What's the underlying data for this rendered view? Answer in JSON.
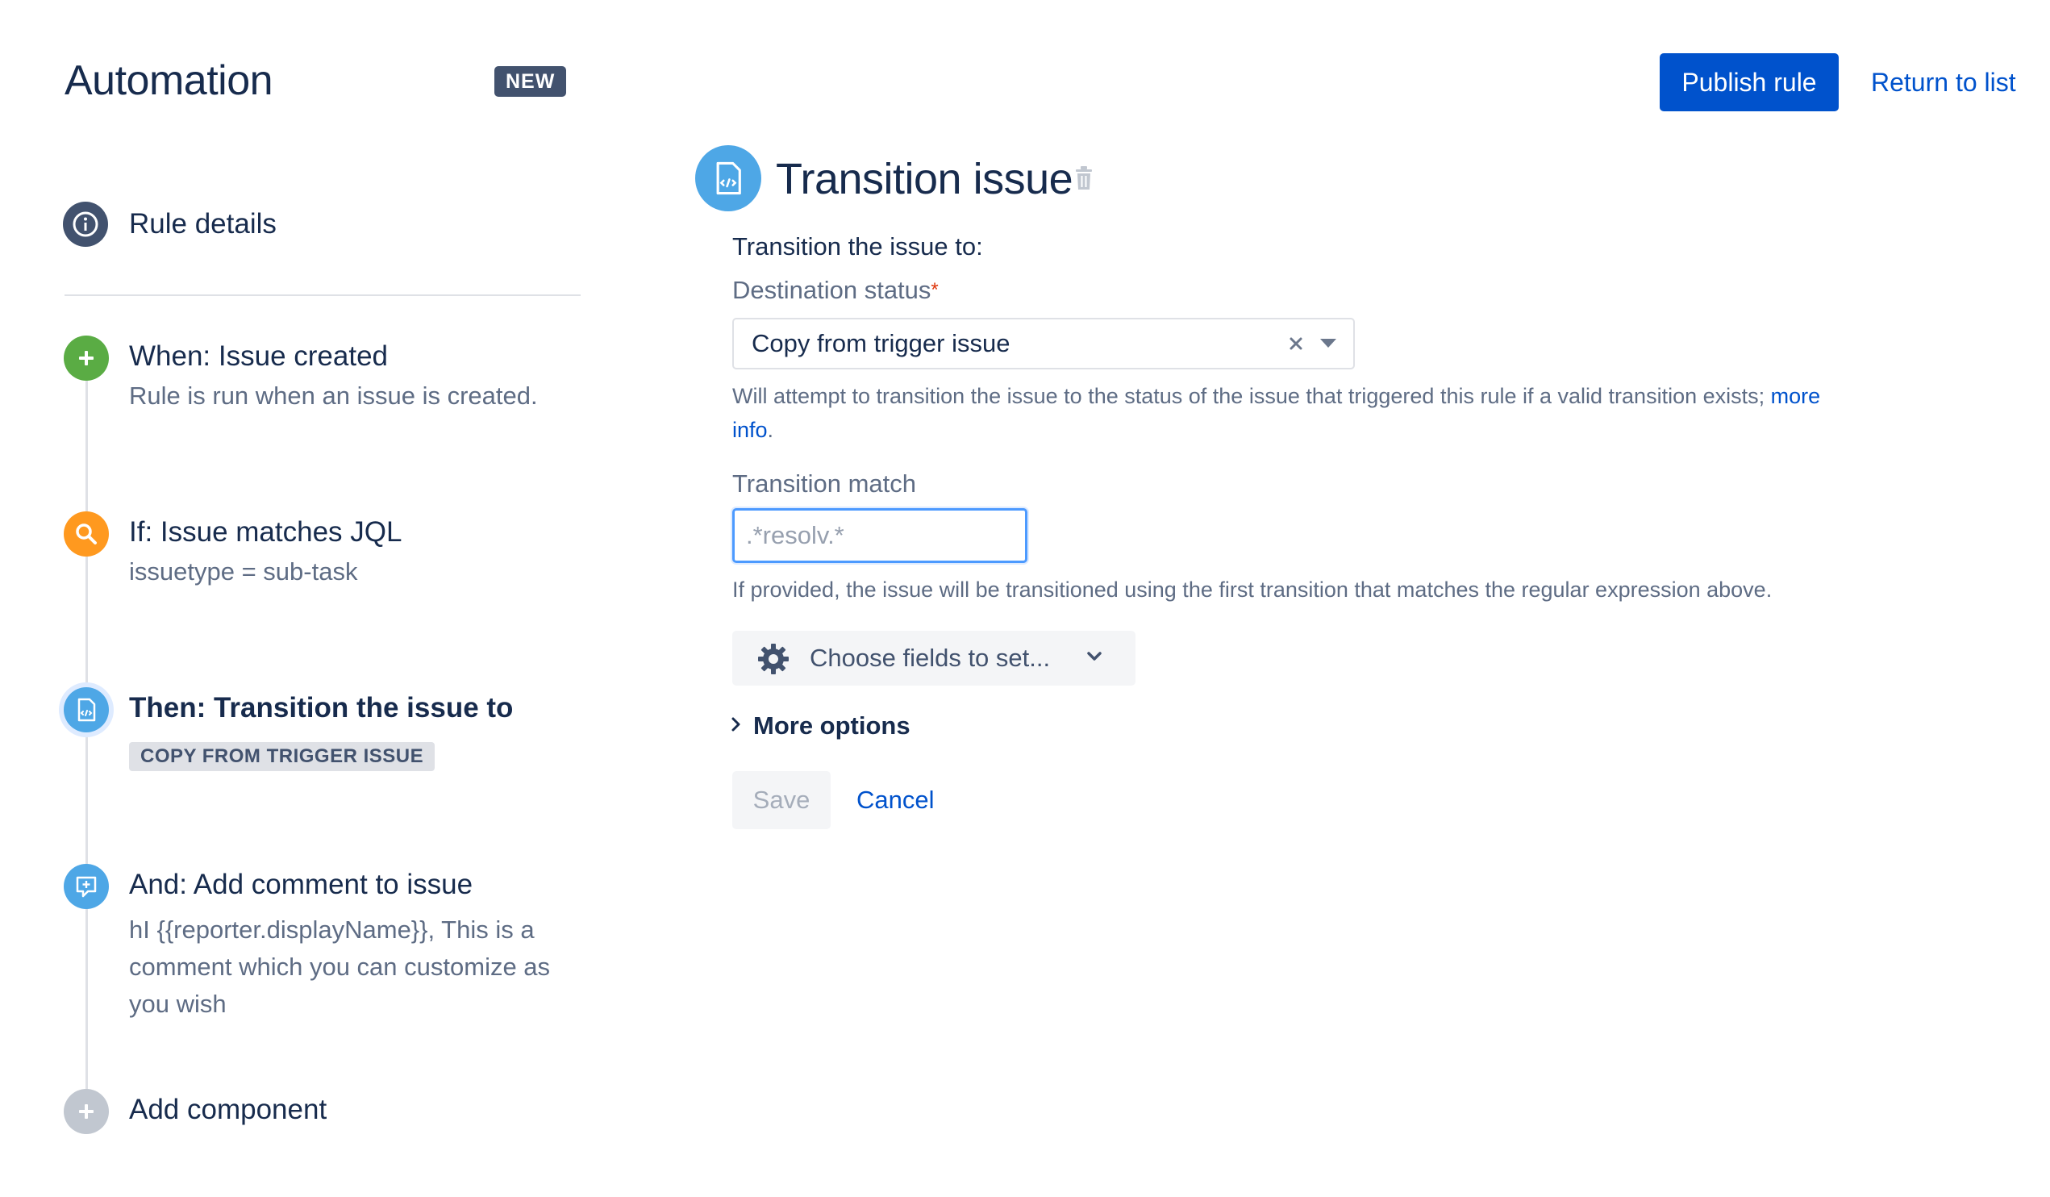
{
  "header": {
    "title": "Automation",
    "badge": "NEW",
    "publish_label": "Publish rule",
    "return_label": "Return to list"
  },
  "sidebar": {
    "rule_details": "Rule details",
    "steps": [
      {
        "icon": "plus-icon",
        "title": "When: Issue created",
        "subtitle": "Rule is run when an issue is created.",
        "color": "#5aac44"
      },
      {
        "icon": "search-icon",
        "title": "If: Issue matches JQL",
        "subtitle": "issuetype = sub-task",
        "color": "#ff991f"
      },
      {
        "icon": "transition-icon",
        "title": "Then: Transition the issue to",
        "lozenge": "COPY FROM TRIGGER ISSUE",
        "color": "#4ea7e6",
        "selected": true
      },
      {
        "icon": "comment-icon",
        "title": "And: Add comment to issue",
        "subtitle_lines": [
          "hI {{reporter.displayName}}, This is a",
          "comment which you can customize as",
          "you wish"
        ],
        "color": "#4ea7e6"
      }
    ],
    "add_component": "Add component"
  },
  "panel": {
    "title": "Transition issue",
    "section_label": "Transition the issue to:",
    "destination_label": "Destination status",
    "required_mark": "*",
    "destination_value": "Copy from trigger issue",
    "destination_help": "Will attempt to transition the issue to the status of the issue that triggered this rule if a valid transition exists;",
    "more_info_link_1": "more",
    "more_info_link_2": "info",
    "more_info_period": ".",
    "match_label": "Transition match",
    "match_placeholder": ".*resolv.*",
    "match_help": "If provided, the issue will be transitioned using the first transition that matches the regular expression above.",
    "choose_fields_label": "Choose fields to set...",
    "more_options_label": "More options",
    "save_label": "Save",
    "cancel_label": "Cancel"
  },
  "colors": {
    "primary": "#0052cc",
    "text": "#172b4d",
    "subtle_text": "#5e6c84",
    "focus": "#4c9aff",
    "required": "#de350b"
  }
}
